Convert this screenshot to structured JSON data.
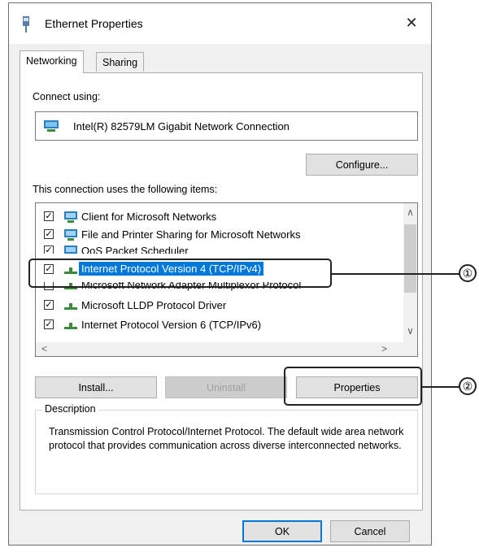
{
  "window": {
    "title": "Ethernet Properties",
    "close_icon": "close-icon"
  },
  "tabs": [
    {
      "label": "Networking",
      "active": true
    },
    {
      "label": "Sharing",
      "active": false
    }
  ],
  "connect_using": {
    "label": "Connect using:",
    "adapter": "Intel(R) 82579LM Gigabit Network Connection",
    "configure_label": "Configure..."
  },
  "items": {
    "label": "This connection uses the following items:",
    "list": [
      {
        "label": "Client for Microsoft Networks",
        "checked": true,
        "icon": "network-client-icon"
      },
      {
        "label": "File and Printer Sharing for Microsoft Networks",
        "checked": true,
        "icon": "network-service-icon"
      },
      {
        "label": "QoS Packet Scheduler",
        "checked": true,
        "icon": "network-service-icon"
      },
      {
        "label": "Internet Protocol Version 4 (TCP/IPv4)",
        "checked": true,
        "icon": "protocol-icon",
        "selected": true
      },
      {
        "label": "Microsoft Network Adapter Multiplexor Protocol",
        "checked": false,
        "icon": "protocol-icon"
      },
      {
        "label": "Microsoft LLDP Protocol Driver",
        "checked": true,
        "icon": "protocol-icon"
      },
      {
        "label": "Internet Protocol Version 6 (TCP/IPv6)",
        "checked": true,
        "icon": "protocol-icon"
      }
    ]
  },
  "buttons": {
    "install": "Install...",
    "uninstall": "Uninstall",
    "properties": "Properties",
    "ok": "OK",
    "cancel": "Cancel"
  },
  "description": {
    "legend": "Description",
    "text": "Transmission Control Protocol/Internet Protocol. The default wide area network protocol that provides communication across diverse interconnected networks."
  },
  "callouts": [
    {
      "number": "①"
    },
    {
      "number": "②"
    }
  ],
  "colors": {
    "selection": "#0078d7",
    "dialog_bg": "#f0f0f0"
  }
}
